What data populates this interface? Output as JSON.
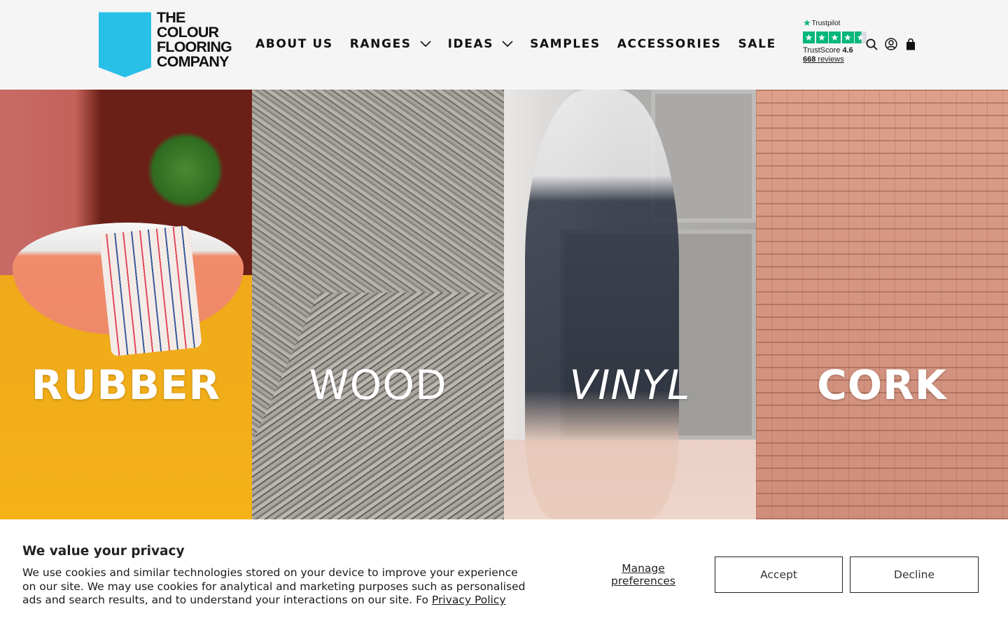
{
  "brand": {
    "logo_lines": [
      "THE",
      "COLOUR",
      "FLOORING",
      "COMPANY"
    ],
    "accent_color": "#29c0e8"
  },
  "nav": {
    "items": [
      {
        "label": "ABOUT US",
        "has_dropdown": false
      },
      {
        "label": "RANGES",
        "has_dropdown": true
      },
      {
        "label": "IDEAS",
        "has_dropdown": true
      },
      {
        "label": "SAMPLES",
        "has_dropdown": false
      },
      {
        "label": "ACCESSORIES",
        "has_dropdown": false
      },
      {
        "label": "SALE",
        "has_dropdown": false
      }
    ]
  },
  "trustpilot": {
    "brand": "Trustpilot",
    "score_label": "TrustScore",
    "score": "4.6",
    "review_count": "668",
    "reviews_label": "reviews",
    "star_color": "#00b67a"
  },
  "header_icons": [
    "search-icon",
    "account-icon",
    "cart-icon"
  ],
  "tiles": [
    {
      "label": "RUBBER",
      "style": "bold"
    },
    {
      "label": "WOOD",
      "style": "light"
    },
    {
      "label": "VINYL",
      "style": "italic"
    },
    {
      "label": "CORK",
      "style": "bold"
    }
  ],
  "cookie": {
    "title": "We value your privacy",
    "text": "We use cookies and similar technologies stored on your device to improve your experience on our site. We may use cookies for analytical and marketing purposes such as personalised ads and search results, and to understand your interactions on our site. Fo ",
    "link_label": "Privacy Policy",
    "manage_label": "Manage preferences",
    "accept_label": "Accept",
    "decline_label": "Decline"
  }
}
